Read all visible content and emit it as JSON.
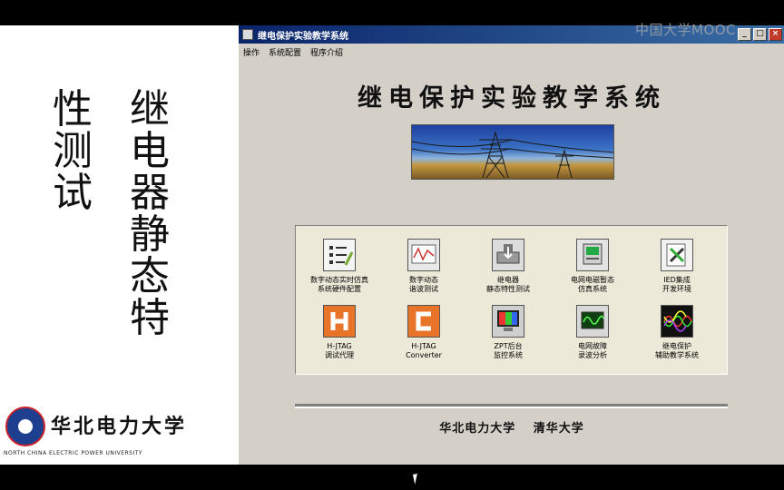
{
  "left_panel": {
    "col_a": [
      "继",
      "电",
      "器",
      "静",
      "态",
      "特"
    ],
    "col_b": [
      "性",
      "测",
      "试"
    ],
    "university_cn": "华北电力大学",
    "university_en": "NORTH CHINA ELECTRIC POWER UNIVERSITY"
  },
  "watermark": "中国大学MOOC",
  "window": {
    "title": "继电保护实验教学系统",
    "controls": {
      "minimize": "_",
      "maximize": "□",
      "close": "×"
    },
    "menu": [
      "操作",
      "系统配置",
      "程序介绍"
    ],
    "heading": "继电保护实验教学系统",
    "tools": [
      {
        "label1": "数字动态实时仿真",
        "label2": "系统硬件配置",
        "icon": "checklist-icon"
      },
      {
        "label1": "数字动态",
        "label2": "谐波测试",
        "icon": "waveform-icon"
      },
      {
        "label1": "继电器",
        "label2": "静态特性测试",
        "icon": "relay-device-icon"
      },
      {
        "label1": "电网电磁暂态",
        "label2": "仿真系统",
        "icon": "computer-icon"
      },
      {
        "label1": "IED集成",
        "label2": "开发环境",
        "icon": "tools-icon"
      },
      {
        "label1": "H-JTAG",
        "label2": "调试代理",
        "icon": "h-letter-icon"
      },
      {
        "label1": "H-JTAG",
        "label2": "Converter",
        "icon": "c-letter-icon"
      },
      {
        "label1": "ZPT后台",
        "label2": "监控系统",
        "icon": "color-monitor-icon"
      },
      {
        "label1": "电网故障",
        "label2": "录波分析",
        "icon": "oscilloscope-icon"
      },
      {
        "label1": "继电保护",
        "label2": "辅助教学系统",
        "icon": "sine-waves-icon"
      }
    ],
    "footer": "华北电力大学 清华大学"
  }
}
